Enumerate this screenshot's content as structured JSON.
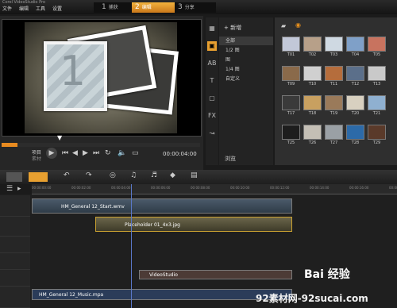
{
  "menubar": {
    "title": "Corel VideoStudio Pro",
    "items": [
      "文件",
      "编辑",
      "工具",
      "设置"
    ]
  },
  "steps": [
    {
      "num": "1",
      "label": "捕获"
    },
    {
      "num": "2",
      "label": "编辑"
    },
    {
      "num": "3",
      "label": "分享"
    }
  ],
  "player": {
    "slide_number": "1",
    "mode_top": "项目",
    "mode_bottom": "素材",
    "timecode": "00:00:04:00",
    "scrub_progress": 0.08
  },
  "library": {
    "add_label": "+ 新增",
    "folders": [
      "全部",
      "1/2 图",
      "图",
      "1/4 图",
      "自定义"
    ],
    "browse_label": "浏览",
    "thumbs": [
      "T01",
      "T02",
      "T03",
      "T04",
      "T05",
      "T09",
      "T10",
      "T11",
      "T12",
      "T13",
      "T17",
      "T18",
      "T19",
      "T20",
      "T21",
      "T25",
      "T26",
      "T27",
      "T28",
      "T29"
    ]
  },
  "timeline": {
    "ruler": [
      "00:00:00:00",
      "00:00:02:00",
      "00:00:04:00",
      "00:00:06:00",
      "00:00:08:00",
      "00:00:10:00",
      "00:00:12:00",
      "00:00:14:00",
      "00:00:16:00",
      "00:00:18:00"
    ],
    "clips": {
      "video": "HM_General 12_Start.wmv",
      "overlay": "Placeholder 01_4x3.jpg",
      "title": "VideoStudio",
      "music": "HM_General 12_Music.mpa"
    }
  },
  "watermark": {
    "line1": "Bai 经验",
    "line2": "92素材网-92sucai.com"
  }
}
